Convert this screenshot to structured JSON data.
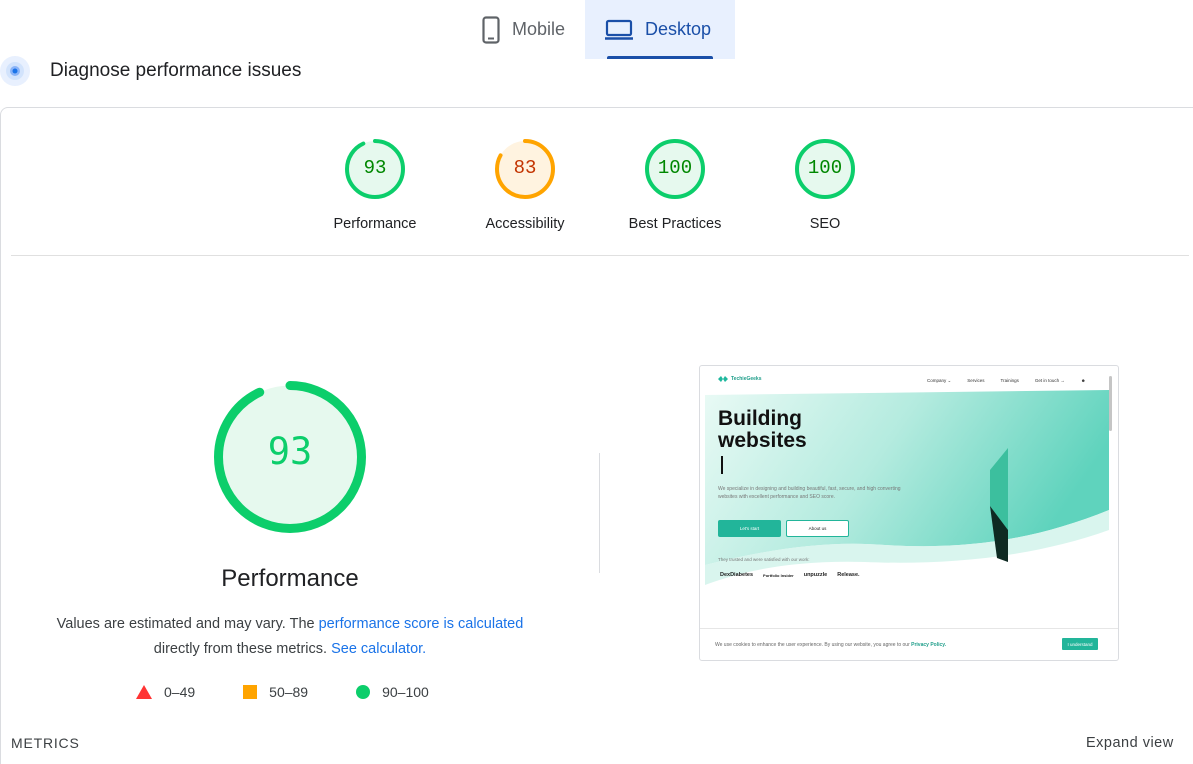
{
  "tabs": {
    "mobile_label": "Mobile",
    "desktop_label": "Desktop",
    "active": "desktop"
  },
  "diagnose": {
    "title": "Diagnose performance issues"
  },
  "gauges": [
    {
      "score": "93",
      "label": "Performance",
      "status": "pass",
      "value": 93
    },
    {
      "score": "83",
      "label": "Accessibility",
      "status": "average",
      "value": 83
    },
    {
      "score": "100",
      "label": "Best Practices",
      "status": "pass",
      "value": 100
    },
    {
      "score": "100",
      "label": "SEO",
      "status": "pass",
      "value": 100
    }
  ],
  "performance": {
    "score": "93",
    "value": 93,
    "title": "Performance",
    "desc_prefix": "Values are estimated and may vary. The ",
    "desc_link": "performance score is calculated",
    "desc_middle": "directly from these metrics.",
    "calc_link": "See calculator."
  },
  "legend": {
    "fail": "0–49",
    "average": "50–89",
    "pass": "90–100"
  },
  "screenshot": {
    "logo_text": "TechieGeeks",
    "nav": [
      "Company ⌄",
      "Services",
      "Trainings",
      "Get in touch →"
    ],
    "headline_1": "Building",
    "headline_2": "websites",
    "paragraph": "We specialize in designing and building beautiful, fast, secure, and high converting websites with excellent performance and SEO score.",
    "primary_button": "Let's start",
    "secondary_button": "About us",
    "trusted": "They trusted and were satisfied with our work:",
    "brands": [
      "DexDiabetes",
      "Portfolio Insider",
      "unpuzzle",
      "Release."
    ],
    "cookie_text": "We use cookies to enhance the user experience. By using our website, you agree to our ",
    "cookie_link": "Privacy Policy.",
    "cookie_button": "I understand"
  },
  "footer": {
    "metrics_label": "METRICS",
    "expand_label": "Expand view"
  },
  "colors": {
    "pass": "#0cce6b",
    "pass_text": "#008800",
    "average": "#ffa400",
    "average_text": "#c33300",
    "fail": "#ff3333",
    "accent": "#1a73e8"
  }
}
